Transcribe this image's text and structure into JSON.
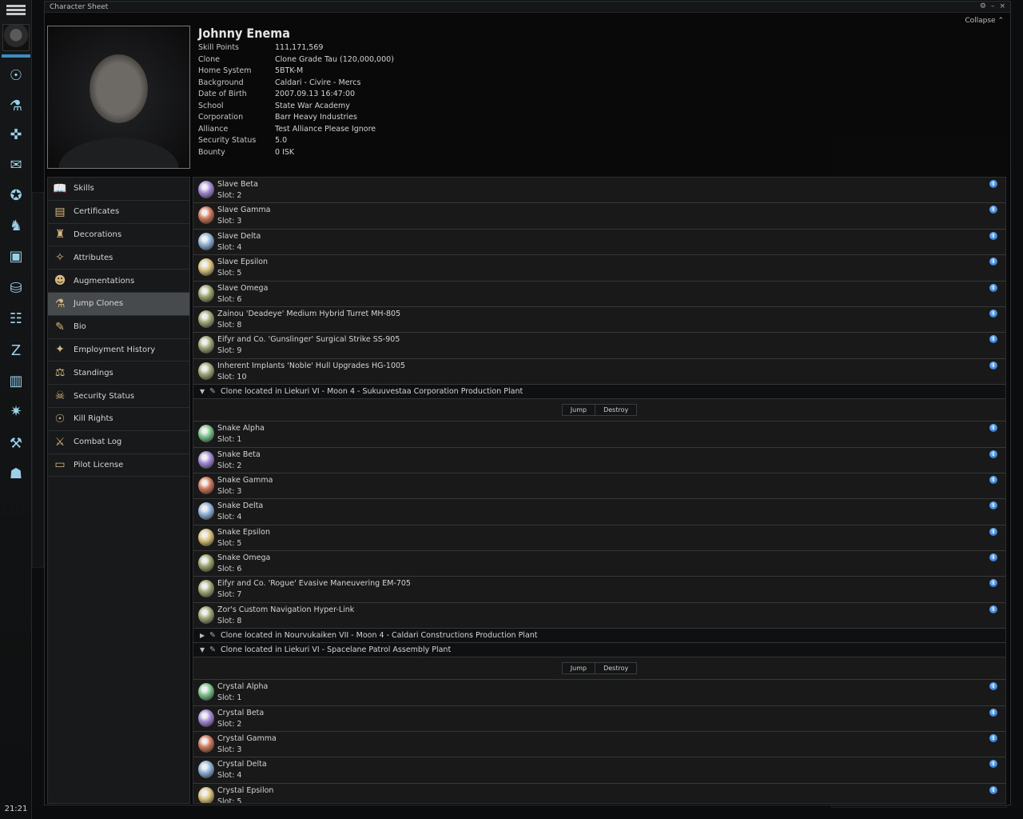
{
  "window": {
    "title": "Character Sheet",
    "collapse_label": "Collapse",
    "controls": [
      "⚙",
      "–",
      "×"
    ]
  },
  "clock": "21:21",
  "neocom": {
    "icons": [
      "skills-icon",
      "science-icon",
      "people-icon",
      "mail-icon",
      "map-icon",
      "fleet-icon",
      "assets-icon",
      "wallet-icon",
      "market-icon",
      "corp-icon",
      "journal-icon",
      "contracts-icon",
      "industry-icon",
      "character-icon"
    ]
  },
  "character": {
    "name": "Johnny Enema",
    "fields": [
      {
        "label": "Skill Points",
        "value": "111,171,569"
      },
      {
        "label": "Clone",
        "value": "Clone Grade Tau (120,000,000)"
      },
      {
        "label": "Home System",
        "value": "5BTK-M"
      },
      {
        "label": "Background",
        "value": "Caldari - Civire - Mercs"
      },
      {
        "label": "Date of Birth",
        "value": "2007.09.13 16:47:00"
      },
      {
        "label": "School",
        "value": "State War Academy"
      },
      {
        "label": "Corporation",
        "value": "Barr Heavy Industries"
      },
      {
        "label": "Alliance",
        "value": "Test Alliance Please Ignore"
      },
      {
        "label": "Security Status",
        "value": "5.0"
      },
      {
        "label": "Bounty",
        "value": "0 ISK"
      }
    ]
  },
  "sidebar": {
    "items": [
      {
        "label": "Skills",
        "icon": "book-icon",
        "glyph": "📖"
      },
      {
        "label": "Certificates",
        "icon": "certificate-icon",
        "glyph": "▤"
      },
      {
        "label": "Decorations",
        "icon": "medal-icon",
        "glyph": "♜"
      },
      {
        "label": "Attributes",
        "icon": "attributes-icon",
        "glyph": "✧"
      },
      {
        "label": "Augmentations",
        "icon": "augmentation-icon",
        "glyph": "☻"
      },
      {
        "label": "Jump Clones",
        "icon": "jump-clone-icon",
        "glyph": "⚗",
        "selected": true
      },
      {
        "label": "Bio",
        "icon": "bio-icon",
        "glyph": "✎"
      },
      {
        "label": "Employment History",
        "icon": "employment-icon",
        "glyph": "✦"
      },
      {
        "label": "Standings",
        "icon": "standings-icon",
        "glyph": "⚖"
      },
      {
        "label": "Security Status",
        "icon": "security-icon",
        "glyph": "☠"
      },
      {
        "label": "Kill Rights",
        "icon": "kill-rights-icon",
        "glyph": "☉"
      },
      {
        "label": "Combat Log",
        "icon": "combat-log-icon",
        "glyph": "⚔"
      },
      {
        "label": "Pilot License",
        "icon": "license-icon",
        "glyph": "▭"
      }
    ]
  },
  "buttons": {
    "jump": "Jump",
    "destroy": "Destroy"
  },
  "clone_list": [
    {
      "type": "implant",
      "name": "Slave Beta",
      "slot": "Slot: 2",
      "color": "#a48bd6"
    },
    {
      "type": "implant",
      "name": "Slave Gamma",
      "slot": "Slot: 3",
      "color": "#d07a5c"
    },
    {
      "type": "implant",
      "name": "Slave Delta",
      "slot": "Slot: 4",
      "color": "#8fb3d8"
    },
    {
      "type": "implant",
      "name": "Slave Epsilon",
      "slot": "Slot: 5",
      "color": "#d8c27a"
    },
    {
      "type": "implant",
      "name": "Slave Omega",
      "slot": "Slot: 6",
      "color": "#9aa66e"
    },
    {
      "type": "implant",
      "name": "Zainou 'Deadeye' Medium Hybrid Turret MH-805",
      "slot": "Slot: 8",
      "color": "#a0a878"
    },
    {
      "type": "implant",
      "name": "Eifyr and Co. 'Gunslinger' Surgical Strike SS-905",
      "slot": "Slot: 9",
      "color": "#a0a878"
    },
    {
      "type": "implant",
      "name": "Inherent Implants 'Noble' Hull Upgrades HG-1005",
      "slot": "Slot: 10",
      "color": "#a0a878"
    },
    {
      "type": "header",
      "expanded": true,
      "text": "Clone located in Liekuri VI - Moon 4 - Sukuuvestaa Corporation Production Plant"
    },
    {
      "type": "actions"
    },
    {
      "type": "implant",
      "name": "Snake Alpha",
      "slot": "Slot: 1",
      "color": "#7bc48c"
    },
    {
      "type": "implant",
      "name": "Snake Beta",
      "slot": "Slot: 2",
      "color": "#a48bd6"
    },
    {
      "type": "implant",
      "name": "Snake Gamma",
      "slot": "Slot: 3",
      "color": "#d07a5c"
    },
    {
      "type": "implant",
      "name": "Snake Delta",
      "slot": "Slot: 4",
      "color": "#8fb3d8"
    },
    {
      "type": "implant",
      "name": "Snake Epsilon",
      "slot": "Slot: 5",
      "color": "#d8c27a"
    },
    {
      "type": "implant",
      "name": "Snake Omega",
      "slot": "Slot: 6",
      "color": "#9aa66e"
    },
    {
      "type": "implant",
      "name": "Eifyr and Co. 'Rogue' Evasive Maneuvering EM-705",
      "slot": "Slot: 7",
      "color": "#a0a878"
    },
    {
      "type": "implant",
      "name": "Zor's Custom Navigation Hyper-Link",
      "slot": "Slot: 8",
      "color": "#a0a878"
    },
    {
      "type": "header",
      "expanded": false,
      "text": "Clone located in Nourvukaiken VII - Moon 4 - Caldari Constructions Production Plant"
    },
    {
      "type": "header",
      "expanded": true,
      "text": "Clone located in Liekuri VI - Spacelane Patrol Assembly Plant"
    },
    {
      "type": "actions"
    },
    {
      "type": "implant",
      "name": "Crystal Alpha",
      "slot": "Slot: 1",
      "color": "#7bc48c"
    },
    {
      "type": "implant",
      "name": "Crystal Beta",
      "slot": "Slot: 2",
      "color": "#a48bd6"
    },
    {
      "type": "implant",
      "name": "Crystal Gamma",
      "slot": "Slot: 3",
      "color": "#d07a5c"
    },
    {
      "type": "implant",
      "name": "Crystal Delta",
      "slot": "Slot: 4",
      "color": "#8fb3d8"
    },
    {
      "type": "implant",
      "name": "Crystal Epsilon",
      "slot": "Slot: 5",
      "color": "#d8c27a"
    }
  ]
}
